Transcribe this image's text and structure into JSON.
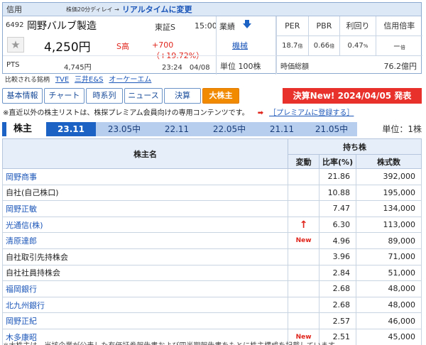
{
  "quote": {
    "credit_label": "信用",
    "delay_note": "株価20分ディレイ →",
    "realtime_link": "リアルタイムに変更",
    "code": "6492",
    "company_name": "岡野バルブ製造",
    "market": "東証S",
    "time": "15:00",
    "performance_label": "業績",
    "sector": "機械",
    "price": "4,250円",
    "s_high": "S高",
    "change": "+700（+19.72%）",
    "pts_label": "PTS",
    "pts_price": "4,745円",
    "pts_time": "23:24　04/08",
    "unit": "単位 100株",
    "indicators": {
      "headers": [
        "PER",
        "PBR",
        "利回り",
        "信用倍率"
      ],
      "values": [
        "18.7",
        "0.66",
        "0.47",
        "ー"
      ],
      "suffixes": [
        "倍",
        "倍",
        "%",
        "倍"
      ]
    },
    "market_cap_label": "時価総額",
    "market_cap_value": "76.2億円"
  },
  "related": {
    "label": "比較される銘柄",
    "items": [
      "TVE",
      "三井E&S",
      "オーケーエム"
    ]
  },
  "tabs": [
    "基本情報",
    "チャート",
    "時系列",
    "ニュース",
    "決算",
    "大株主"
  ],
  "banner": "決算New!  2024/04/05 発表",
  "notice": {
    "text": "※直近以外の株主リストは、株探プレミアム会員向けの専用コンテンツです。",
    "arrow": "➡",
    "link": "［プレミアムに登録する］"
  },
  "period": {
    "label": "株主",
    "items": [
      "23.11",
      "23.05中",
      "22.11",
      "22.05中",
      "21.11",
      "21.05中"
    ],
    "unit": "単位：1株"
  },
  "table": {
    "header_name": "株主名",
    "header_holdings": "持ち株",
    "header_change": "変動",
    "header_ratio": "比率(%)",
    "header_shares": "株式数",
    "rows": [
      {
        "name": "岡野商事",
        "link": true,
        "change": "",
        "ratio": "21.86",
        "shares": "392,000"
      },
      {
        "name": "自社(自己株口)",
        "link": false,
        "change": "",
        "ratio": "10.88",
        "shares": "195,000"
      },
      {
        "name": "岡野正敏",
        "link": true,
        "change": "",
        "ratio": "7.47",
        "shares": "134,000"
      },
      {
        "name": "光通信(株)",
        "link": true,
        "change": "↑",
        "ratio": "6.30",
        "shares": "113,000"
      },
      {
        "name": "清原達郎",
        "link": true,
        "change": "New",
        "ratio": "4.96",
        "shares": "89,000"
      },
      {
        "name": "自社取引先持株会",
        "link": false,
        "change": "",
        "ratio": "3.96",
        "shares": "71,000"
      },
      {
        "name": "自社社員持株会",
        "link": false,
        "change": "",
        "ratio": "2.84",
        "shares": "51,000"
      },
      {
        "name": "福岡銀行",
        "link": true,
        "change": "",
        "ratio": "2.68",
        "shares": "48,000"
      },
      {
        "name": "北九州銀行",
        "link": true,
        "change": "",
        "ratio": "2.68",
        "shares": "48,000"
      },
      {
        "name": "岡野正紀",
        "link": true,
        "change": "",
        "ratio": "2.57",
        "shares": "46,000"
      },
      {
        "name": "木多康昭",
        "link": true,
        "change": "New",
        "ratio": "2.51",
        "shares": "45,000"
      }
    ]
  },
  "footer": "※大株主は、当該企業が公表した有価証券報告書および四半期報告書をもとに株主構成を記載しています。"
}
